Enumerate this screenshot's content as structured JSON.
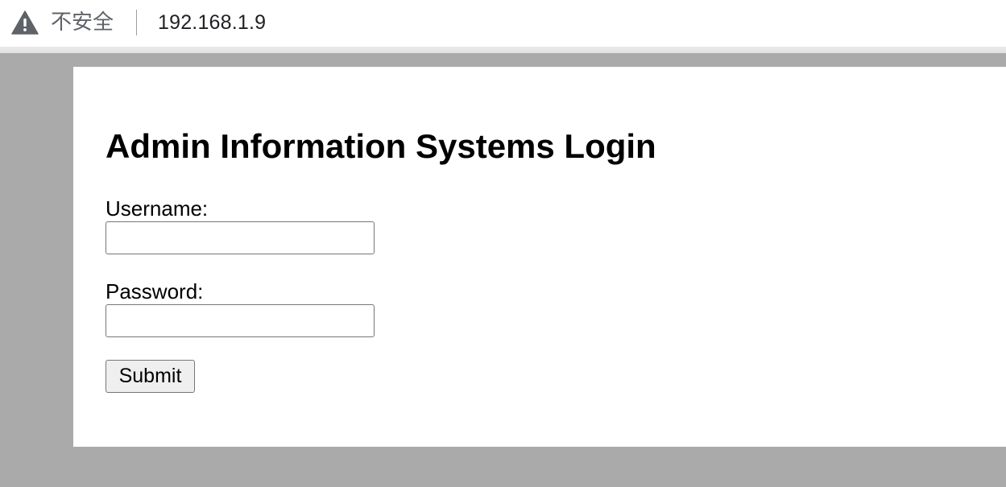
{
  "browser": {
    "security_icon": "warning-triangle-icon",
    "security_text": "不安全",
    "url": "192.168.1.9"
  },
  "page": {
    "title": "Admin Information Systems Login",
    "form": {
      "username_label": "Username:",
      "username_value": "",
      "password_label": "Password:",
      "password_value": "",
      "submit_label": "Submit"
    }
  },
  "colors": {
    "background": "#aaaaaa",
    "panel": "#ffffff",
    "button": "#efefef",
    "border": "#767676"
  }
}
